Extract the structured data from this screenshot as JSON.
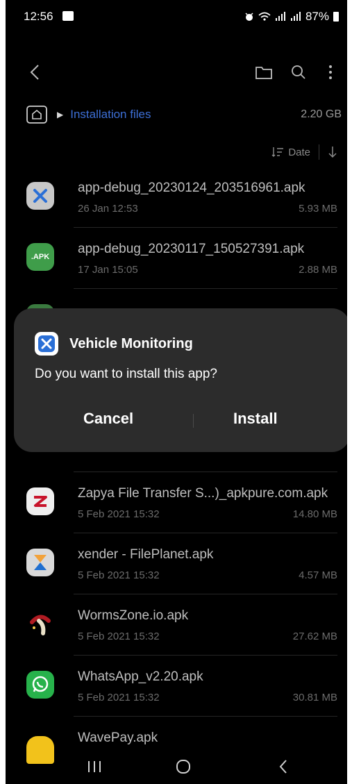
{
  "status": {
    "time": "12:56",
    "battery": "87%"
  },
  "breadcrumb": {
    "path": "Installation files",
    "size": "2.20 GB"
  },
  "sort": {
    "label": "Date"
  },
  "files": [
    {
      "name": "app-debug_20230124_203516961.apk",
      "date": "26 Jan 12:53",
      "size": "5.93 MB",
      "icon": "vehicle-app-icon"
    },
    {
      "name": "app-debug_20230117_150527391.apk",
      "date": "17 Jan 15:05",
      "size": "2.88 MB",
      "icon": "apk-icon"
    },
    {
      "name": "Zapya File Transfer S...)_apkpure.com.apk",
      "date": "5 Feb 2021 15:32",
      "size": "14.80 MB",
      "icon": "zapya-icon"
    },
    {
      "name": "xender - FilePlanet.apk",
      "date": "5 Feb 2021 15:32",
      "size": "4.57 MB",
      "icon": "xender-icon"
    },
    {
      "name": "WormsZone.io.apk",
      "date": "5 Feb 2021 15:32",
      "size": "27.62 MB",
      "icon": "wormszone-icon"
    },
    {
      "name": "WhatsApp_v2.20.apk",
      "date": "5 Feb 2021 15:32",
      "size": "30.81 MB",
      "icon": "whatsapp-icon"
    },
    {
      "name": "WavePay.apk",
      "date": "",
      "size": "",
      "icon": "wavepay-icon"
    }
  ],
  "apk_badge": ".APK",
  "dialog": {
    "app_name": "Vehicle Monitoring",
    "message": "Do you want to install this app?",
    "cancel": "Cancel",
    "install": "Install"
  }
}
